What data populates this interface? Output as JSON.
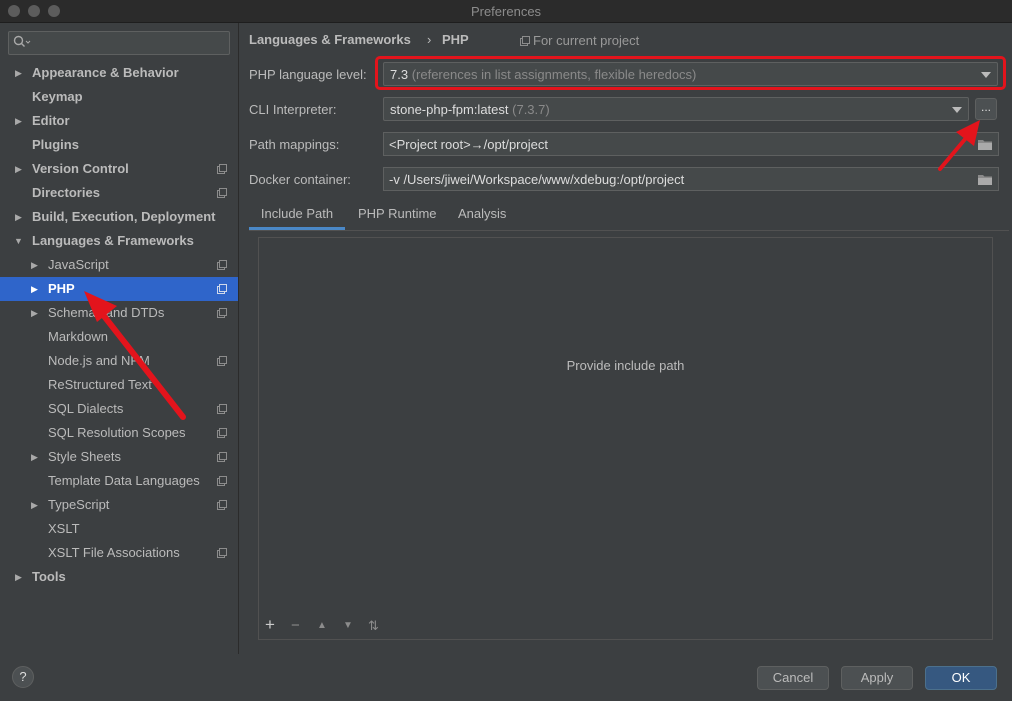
{
  "window": {
    "title": "Preferences"
  },
  "search": {
    "placeholder": "",
    "value": ""
  },
  "sidebar": {
    "items": [
      {
        "label": "Appearance & Behavior",
        "arrow": "▶"
      },
      {
        "label": "Keymap"
      },
      {
        "label": "Editor",
        "arrow": "▶"
      },
      {
        "label": "Plugins"
      },
      {
        "label": "Version Control",
        "arrow": "▶"
      },
      {
        "label": "Directories"
      },
      {
        "label": "Build, Execution, Deployment",
        "arrow": "▶"
      },
      {
        "label": "Languages & Frameworks",
        "arrow": "▼"
      },
      {
        "label": "JavaScript",
        "arrow": "▶"
      },
      {
        "label": "PHP",
        "arrow": "▶"
      },
      {
        "label": "Schemas and DTDs",
        "arrow": "▶"
      },
      {
        "label": "Markdown"
      },
      {
        "label": "Node.js and NPM"
      },
      {
        "label": "ReStructured Text"
      },
      {
        "label": "SQL Dialects"
      },
      {
        "label": "SQL Resolution Scopes"
      },
      {
        "label": "Style Sheets",
        "arrow": "▶"
      },
      {
        "label": "Template Data Languages"
      },
      {
        "label": "TypeScript",
        "arrow": "▶"
      },
      {
        "label": "XSLT"
      },
      {
        "label": "XSLT File Associations"
      },
      {
        "label": "Tools",
        "arrow": "▶"
      }
    ]
  },
  "header": {
    "breadcrumb_parent": "Languages & Frameworks",
    "breadcrumb_sep": "›",
    "breadcrumb_current": "PHP",
    "scope": "For current project"
  },
  "form": {
    "language_level_label": "PHP language level:",
    "language_level_value": "7.3",
    "language_level_desc": "(references in list assignments, flexible heredocs)",
    "cli_label": "CLI Interpreter:",
    "cli_value": "stone-php-fpm:latest",
    "cli_version": "(7.3.7)",
    "cli_more": "...",
    "path_label": "Path mappings:",
    "path_value": "<Project root>→/opt/project",
    "docker_label": "Docker container:",
    "docker_value": "-v /Users/jiwei/Workspace/www/xdebug:/opt/project"
  },
  "tabs": [
    {
      "label": "Include Path"
    },
    {
      "label": "PHP Runtime"
    },
    {
      "label": "Analysis"
    }
  ],
  "include_panel": {
    "empty_text": "Provide include path"
  },
  "toolbar": {
    "add": "+",
    "remove": "−",
    "up": "▲",
    "down": "▼",
    "sort": "⇅"
  },
  "footer": {
    "help": "?",
    "cancel": "Cancel",
    "apply": "Apply",
    "ok": "OK"
  },
  "colors": {
    "selection": "#2f65ca",
    "annotation": "#e3141c",
    "primary_button": "#365880"
  }
}
